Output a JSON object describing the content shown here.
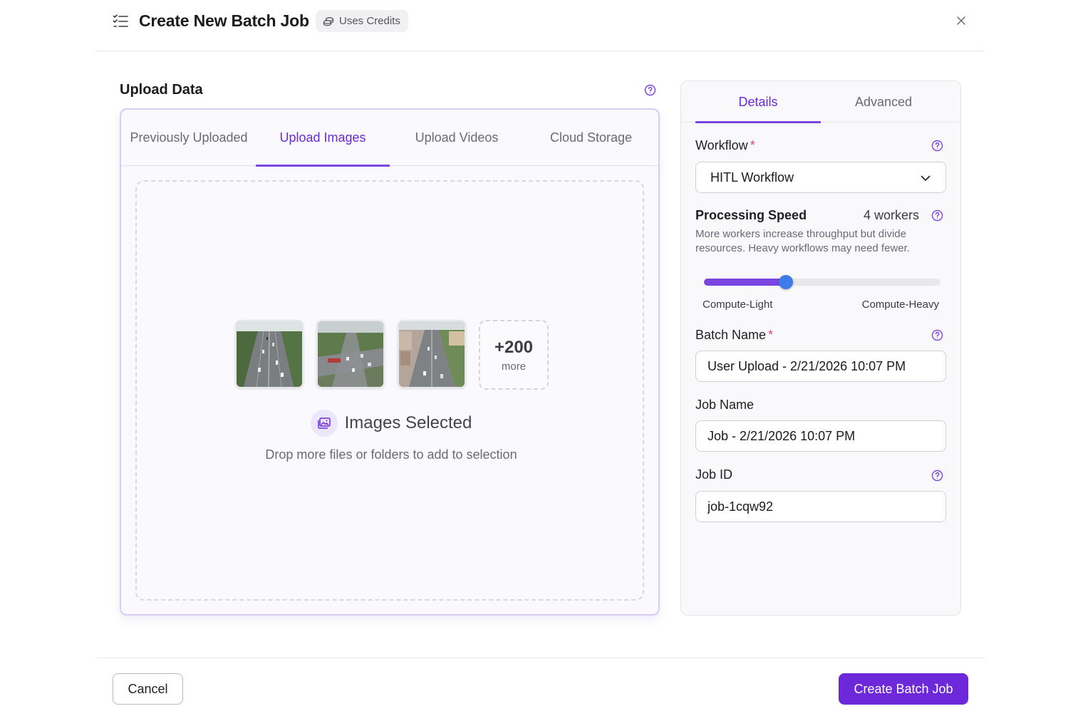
{
  "header": {
    "title": "Create New Batch Job",
    "badge": "Uses Credits"
  },
  "upload": {
    "title": "Upload Data",
    "tabs": [
      {
        "label": "Previously Uploaded"
      },
      {
        "label": "Upload Images",
        "active": true
      },
      {
        "label": "Upload Videos"
      },
      {
        "label": "Cloud Storage"
      }
    ],
    "more_count": "+200",
    "more_label": "more",
    "status": "Images Selected",
    "hint": "Drop more files or folders to add to selection"
  },
  "panel": {
    "tabs": [
      {
        "label": "Details",
        "active": true
      },
      {
        "label": "Advanced"
      }
    ],
    "workflow": {
      "label": "Workflow",
      "required_mark": "*",
      "value": "HITL Workflow"
    },
    "speed": {
      "label": "Processing Speed",
      "workers": "4 workers",
      "description": "More workers increase throughput but divide resources. Heavy workflows may need fewer.",
      "slider_fraction": 0.345,
      "min_label": "Compute-Light",
      "max_label": "Compute-Heavy"
    },
    "batch_name": {
      "label": "Batch Name",
      "required_mark": "*",
      "value": "User Upload - 2/21/2026 10:07 PM"
    },
    "job_name": {
      "label": "Job Name",
      "value": "Job - 2/21/2026 10:07 PM"
    },
    "job_id": {
      "label": "Job ID",
      "value": "job-1cqw92"
    }
  },
  "footer": {
    "cancel": "Cancel",
    "create": "Create Batch Job"
  },
  "colors": {
    "accent": "#6d28d9",
    "slider_thumb": "#3f7ae8",
    "required": "#e0457b"
  }
}
